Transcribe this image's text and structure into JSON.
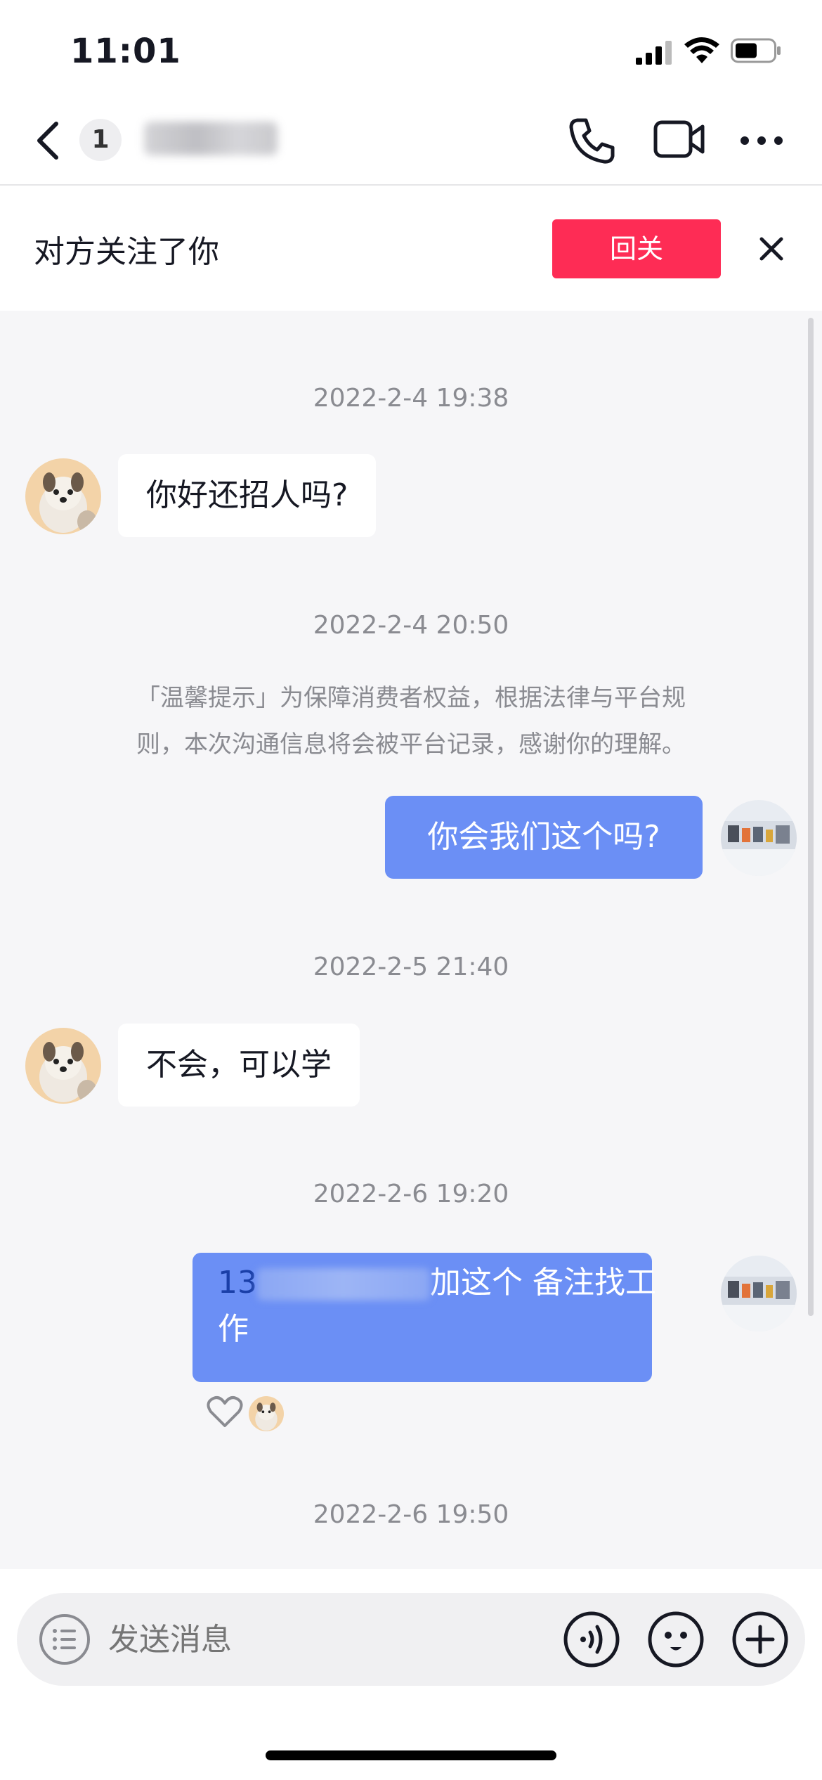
{
  "status_bar": {
    "time": "11:01"
  },
  "nav": {
    "unread_count": "1",
    "contact_name": ""
  },
  "follow_banner": {
    "text": "对方关注了你",
    "button_label": "回关"
  },
  "messages": {
    "ts1": "2022-2-4 19:38",
    "msg1": "你好还招人吗?",
    "ts2": "2022-2-4 20:50",
    "notice_line1": "「温馨提示」为保障消费者权益，根据法律与平台规",
    "notice_line2": "则，本次沟通信息将会被平台记录，感谢你的理解。",
    "msg2": "你会我们这个吗?",
    "ts3": "2022-2-5 21:40",
    "msg3": "不会，可以学",
    "ts4": "2022-2-6 19:20",
    "msg4_prefix": "13",
    "msg4_after": "加这个 备注找工",
    "msg4_line2": "作",
    "ts5": "2022-2-6 19:50"
  },
  "input": {
    "placeholder": "发送消息"
  },
  "colors": {
    "accent": "#fe2c55",
    "outgoing_bubble": "#6b8ff5",
    "background": "#f6f6f8"
  }
}
